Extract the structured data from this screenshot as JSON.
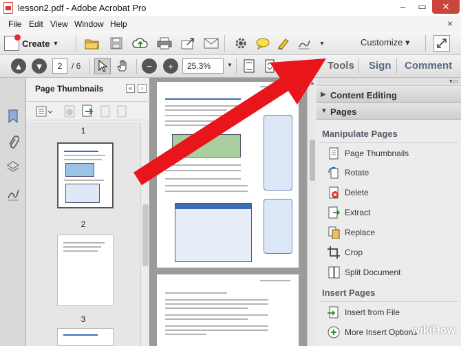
{
  "window": {
    "title": "lesson2.pdf - Adobe Acrobat Pro",
    "minimize": "–",
    "maximize": "▭",
    "close": "✕"
  },
  "menu": {
    "items": [
      "File",
      "Edit",
      "View",
      "Window",
      "Help"
    ],
    "close": "×"
  },
  "toolbar": {
    "create_label": "Create",
    "customize_label": "Customize",
    "customize_caret": "▾"
  },
  "navigation": {
    "current_page": "2",
    "total_pages": "/ 6",
    "zoom": "25.3%"
  },
  "pane_tabs": {
    "tools": "Tools",
    "sign": "Sign",
    "comment": "Comment"
  },
  "thumbnails": {
    "title": "Page Thumbnails",
    "pages": [
      "1",
      "2",
      "3"
    ]
  },
  "tools_pane": {
    "content_editing": "Content Editing",
    "pages": "Pages",
    "manipulate_title": "Manipulate Pages",
    "manipulate_items": [
      "Page Thumbnails",
      "Rotate",
      "Delete",
      "Extract",
      "Replace",
      "Crop",
      "Split Document"
    ],
    "insert_title": "Insert Pages",
    "insert_items": [
      "Insert from File",
      "More Insert Options"
    ]
  },
  "colors": {
    "arrow": "#e8161b",
    "delete_icon": "#d32f2f",
    "title_close": "#c9463d"
  },
  "watermark": "wikiHow"
}
